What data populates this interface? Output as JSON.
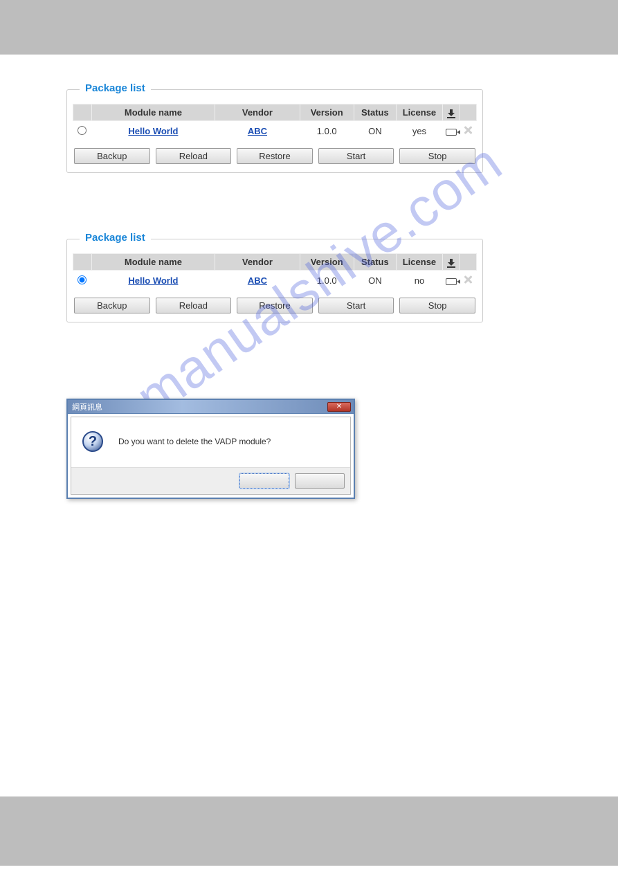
{
  "panels": [
    {
      "title": "Package list",
      "headers": {
        "module": "Module name",
        "vendor": "Vendor",
        "version": "Version",
        "status": "Status",
        "license": "License"
      },
      "row": {
        "selected": false,
        "module": "Hello World",
        "vendor": "ABC",
        "version": "1.0.0",
        "status": "ON",
        "license": "yes"
      },
      "buttons": {
        "backup": "Backup",
        "reload": "Reload",
        "restore": "Restore",
        "start": "Start",
        "stop": "Stop"
      }
    },
    {
      "title": "Package list",
      "headers": {
        "module": "Module name",
        "vendor": "Vendor",
        "version": "Version",
        "status": "Status",
        "license": "License"
      },
      "row": {
        "selected": true,
        "module": "Hello World",
        "vendor": "ABC",
        "version": "1.0.0",
        "status": "ON",
        "license": "no"
      },
      "buttons": {
        "backup": "Backup",
        "reload": "Reload",
        "restore": "Restore",
        "start": "Start",
        "stop": "Stop"
      }
    }
  ],
  "dialog": {
    "title": "網頁訊息",
    "message": "Do you want to delete the VADP module?",
    "ok": "",
    "cancel": ""
  },
  "watermark": "manualshive.com"
}
